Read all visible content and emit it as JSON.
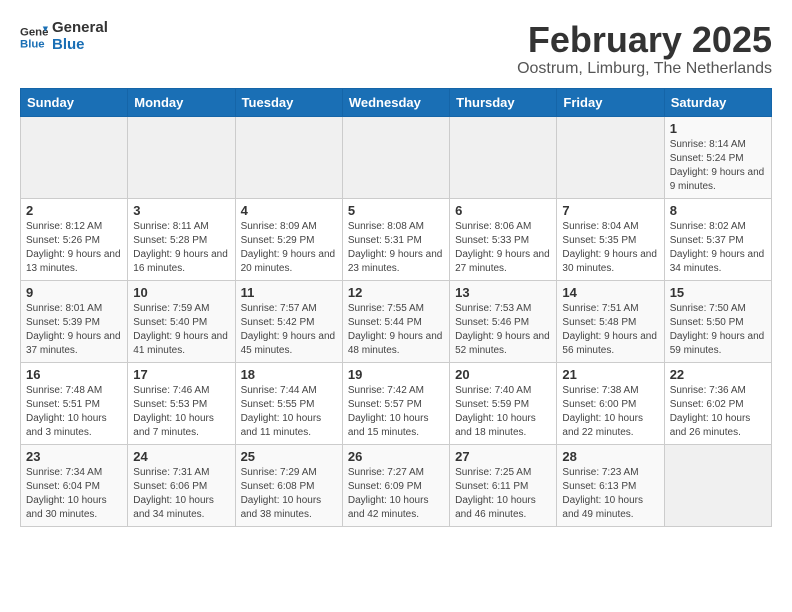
{
  "header": {
    "logo_line1": "General",
    "logo_line2": "Blue",
    "month_year": "February 2025",
    "location": "Oostrum, Limburg, The Netherlands"
  },
  "weekdays": [
    "Sunday",
    "Monday",
    "Tuesday",
    "Wednesday",
    "Thursday",
    "Friday",
    "Saturday"
  ],
  "weeks": [
    [
      {
        "day": "",
        "info": ""
      },
      {
        "day": "",
        "info": ""
      },
      {
        "day": "",
        "info": ""
      },
      {
        "day": "",
        "info": ""
      },
      {
        "day": "",
        "info": ""
      },
      {
        "day": "",
        "info": ""
      },
      {
        "day": "1",
        "info": "Sunrise: 8:14 AM\nSunset: 5:24 PM\nDaylight: 9 hours and 9 minutes."
      }
    ],
    [
      {
        "day": "2",
        "info": "Sunrise: 8:12 AM\nSunset: 5:26 PM\nDaylight: 9 hours and 13 minutes."
      },
      {
        "day": "3",
        "info": "Sunrise: 8:11 AM\nSunset: 5:28 PM\nDaylight: 9 hours and 16 minutes."
      },
      {
        "day": "4",
        "info": "Sunrise: 8:09 AM\nSunset: 5:29 PM\nDaylight: 9 hours and 20 minutes."
      },
      {
        "day": "5",
        "info": "Sunrise: 8:08 AM\nSunset: 5:31 PM\nDaylight: 9 hours and 23 minutes."
      },
      {
        "day": "6",
        "info": "Sunrise: 8:06 AM\nSunset: 5:33 PM\nDaylight: 9 hours and 27 minutes."
      },
      {
        "day": "7",
        "info": "Sunrise: 8:04 AM\nSunset: 5:35 PM\nDaylight: 9 hours and 30 minutes."
      },
      {
        "day": "8",
        "info": "Sunrise: 8:02 AM\nSunset: 5:37 PM\nDaylight: 9 hours and 34 minutes."
      }
    ],
    [
      {
        "day": "9",
        "info": "Sunrise: 8:01 AM\nSunset: 5:39 PM\nDaylight: 9 hours and 37 minutes."
      },
      {
        "day": "10",
        "info": "Sunrise: 7:59 AM\nSunset: 5:40 PM\nDaylight: 9 hours and 41 minutes."
      },
      {
        "day": "11",
        "info": "Sunrise: 7:57 AM\nSunset: 5:42 PM\nDaylight: 9 hours and 45 minutes."
      },
      {
        "day": "12",
        "info": "Sunrise: 7:55 AM\nSunset: 5:44 PM\nDaylight: 9 hours and 48 minutes."
      },
      {
        "day": "13",
        "info": "Sunrise: 7:53 AM\nSunset: 5:46 PM\nDaylight: 9 hours and 52 minutes."
      },
      {
        "day": "14",
        "info": "Sunrise: 7:51 AM\nSunset: 5:48 PM\nDaylight: 9 hours and 56 minutes."
      },
      {
        "day": "15",
        "info": "Sunrise: 7:50 AM\nSunset: 5:50 PM\nDaylight: 9 hours and 59 minutes."
      }
    ],
    [
      {
        "day": "16",
        "info": "Sunrise: 7:48 AM\nSunset: 5:51 PM\nDaylight: 10 hours and 3 minutes."
      },
      {
        "day": "17",
        "info": "Sunrise: 7:46 AM\nSunset: 5:53 PM\nDaylight: 10 hours and 7 minutes."
      },
      {
        "day": "18",
        "info": "Sunrise: 7:44 AM\nSunset: 5:55 PM\nDaylight: 10 hours and 11 minutes."
      },
      {
        "day": "19",
        "info": "Sunrise: 7:42 AM\nSunset: 5:57 PM\nDaylight: 10 hours and 15 minutes."
      },
      {
        "day": "20",
        "info": "Sunrise: 7:40 AM\nSunset: 5:59 PM\nDaylight: 10 hours and 18 minutes."
      },
      {
        "day": "21",
        "info": "Sunrise: 7:38 AM\nSunset: 6:00 PM\nDaylight: 10 hours and 22 minutes."
      },
      {
        "day": "22",
        "info": "Sunrise: 7:36 AM\nSunset: 6:02 PM\nDaylight: 10 hours and 26 minutes."
      }
    ],
    [
      {
        "day": "23",
        "info": "Sunrise: 7:34 AM\nSunset: 6:04 PM\nDaylight: 10 hours and 30 minutes."
      },
      {
        "day": "24",
        "info": "Sunrise: 7:31 AM\nSunset: 6:06 PM\nDaylight: 10 hours and 34 minutes."
      },
      {
        "day": "25",
        "info": "Sunrise: 7:29 AM\nSunset: 6:08 PM\nDaylight: 10 hours and 38 minutes."
      },
      {
        "day": "26",
        "info": "Sunrise: 7:27 AM\nSunset: 6:09 PM\nDaylight: 10 hours and 42 minutes."
      },
      {
        "day": "27",
        "info": "Sunrise: 7:25 AM\nSunset: 6:11 PM\nDaylight: 10 hours and 46 minutes."
      },
      {
        "day": "28",
        "info": "Sunrise: 7:23 AM\nSunset: 6:13 PM\nDaylight: 10 hours and 49 minutes."
      },
      {
        "day": "",
        "info": ""
      }
    ]
  ]
}
